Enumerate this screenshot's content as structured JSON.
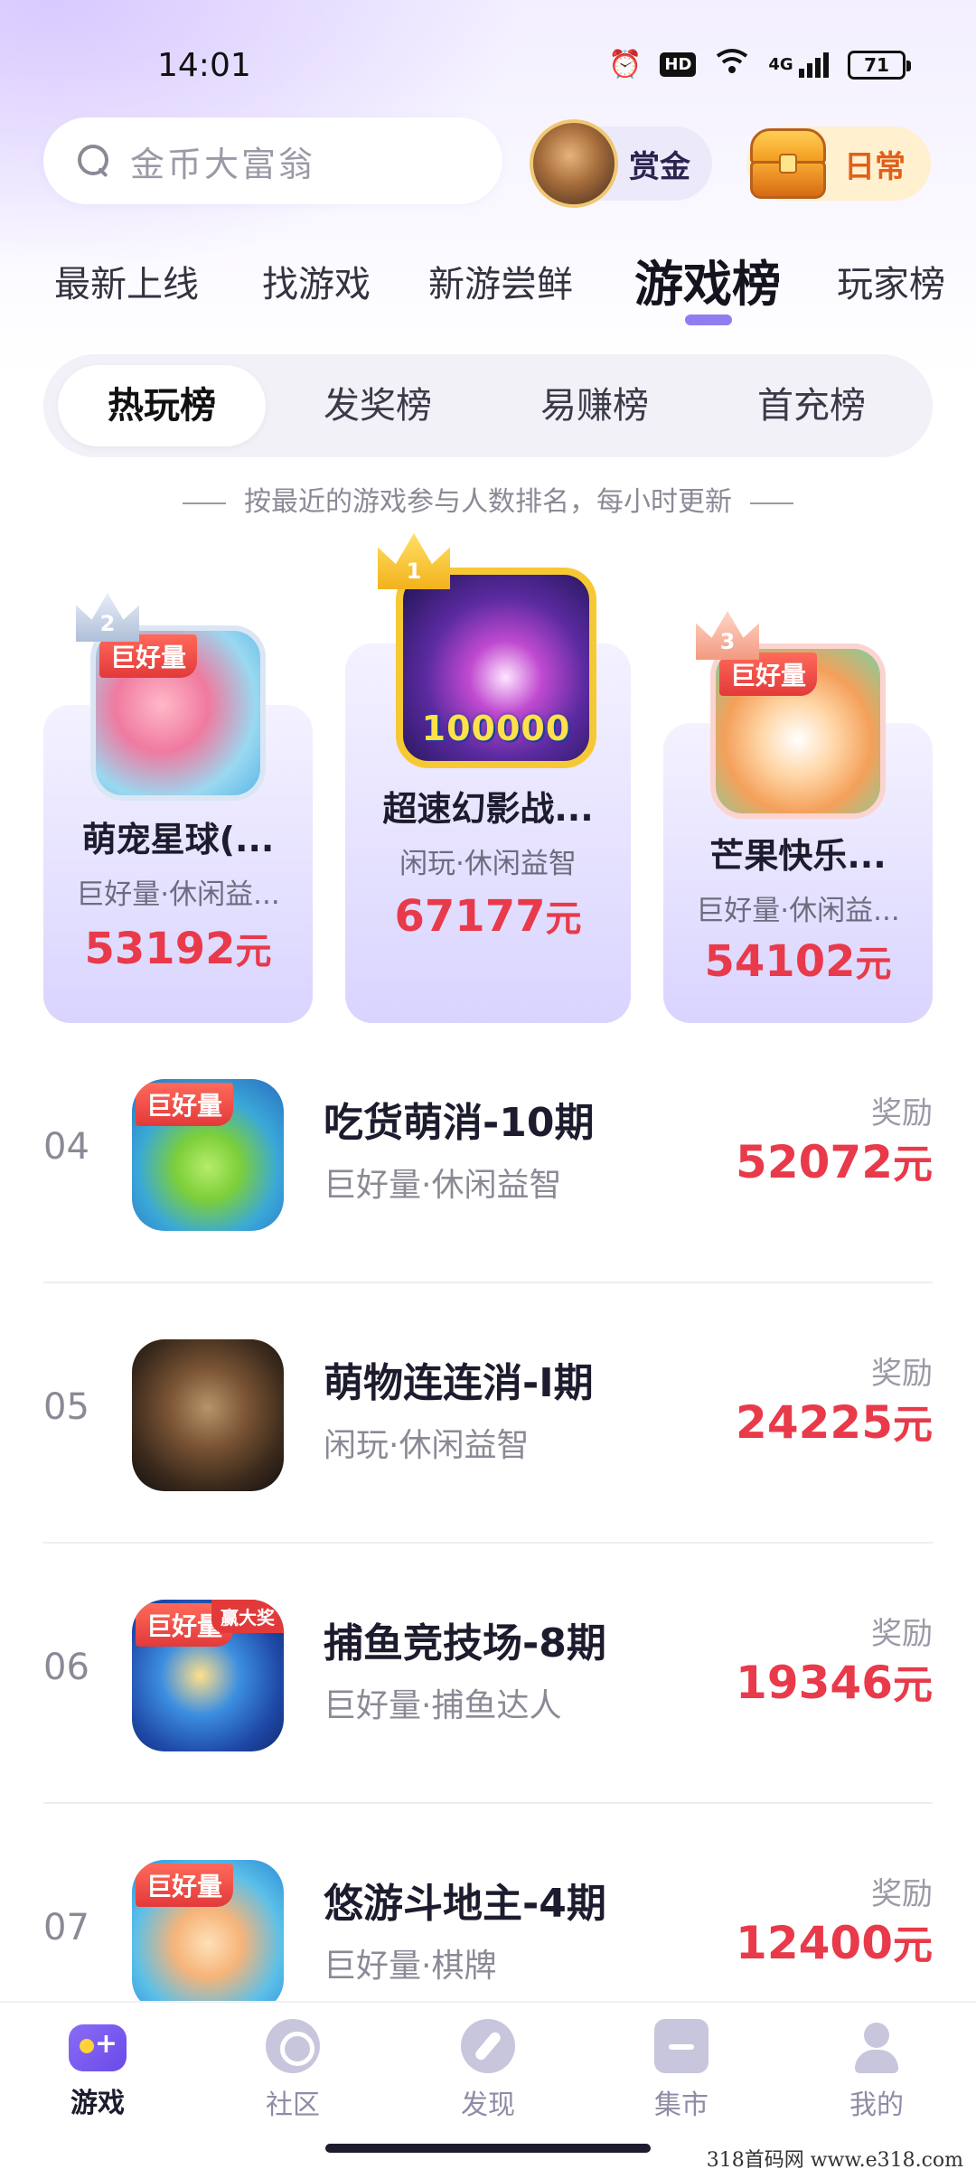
{
  "status_bar": {
    "time": "14:01",
    "icons": [
      "alarm-icon",
      "hd-icon",
      "wifi-icon",
      "4g-signal-icon"
    ],
    "hd_label": "HD",
    "network_label": "4G",
    "battery": "71"
  },
  "search": {
    "placeholder": "金币大富翁",
    "bounty_label": "赏金",
    "daily_label": "日常"
  },
  "main_tabs": [
    {
      "label": "最新上线",
      "active": false
    },
    {
      "label": "找游戏",
      "active": false
    },
    {
      "label": "新游尝鲜",
      "active": false
    },
    {
      "label": "游戏榜",
      "active": true
    },
    {
      "label": "玩家榜",
      "active": false
    }
  ],
  "sub_tabs": [
    {
      "label": "热玩榜",
      "active": true
    },
    {
      "label": "发奖榜",
      "active": false
    },
    {
      "label": "易赚榜",
      "active": false
    },
    {
      "label": "首充榜",
      "active": false
    }
  ],
  "rank_note": "按最近的游戏参与人数排名，每小时更新",
  "podium": {
    "first": {
      "rank": "1",
      "name": "超速幻影战...",
      "tags": "闲玩·休闲益智",
      "reward": "67177",
      "unit": "元",
      "icon_text": "100000"
    },
    "second": {
      "rank": "2",
      "name": "萌宠星球(...",
      "tags": "巨好量·休闲益...",
      "reward": "53192",
      "unit": "元",
      "badge": "巨好量"
    },
    "third": {
      "rank": "3",
      "name": "芒果快乐...",
      "tags": "巨好量·休闲益...",
      "reward": "54102",
      "unit": "元",
      "badge": "巨好量"
    }
  },
  "list": [
    {
      "rank": "04",
      "title": "吃货萌消-10期",
      "tags": "巨好量·休闲益智",
      "reward_label": "奖励",
      "reward": "52072",
      "unit": "元",
      "badge": "巨好量"
    },
    {
      "rank": "05",
      "title": "萌物连连消-I期",
      "tags": "闲玩·休闲益智",
      "reward_label": "奖励",
      "reward": "24225",
      "unit": "元"
    },
    {
      "rank": "06",
      "title": "捕鱼竞技场-8期",
      "tags": "巨好量·捕鱼达人",
      "reward_label": "奖励",
      "reward": "19346",
      "unit": "元",
      "badge": "巨好量",
      "corner": "赢大奖"
    },
    {
      "rank": "07",
      "title": "悠游斗地主-4期",
      "tags": "巨好量·棋牌",
      "reward_label": "奖励",
      "reward": "12400",
      "unit": "元",
      "badge": "巨好量"
    }
  ],
  "bottom_nav": [
    {
      "label": "游戏",
      "icon": "gamepad-icon",
      "active": true
    },
    {
      "label": "社区",
      "icon": "community-icon",
      "active": false
    },
    {
      "label": "发现",
      "icon": "compass-icon",
      "active": false
    },
    {
      "label": "集市",
      "icon": "market-icon",
      "active": false
    },
    {
      "label": "我的",
      "icon": "profile-icon",
      "active": false
    }
  ],
  "watermark": "318首码网  www.e318.com",
  "colors": {
    "accent": "#8f7ef2",
    "reward_red": "#e83a4a",
    "card_gradient_bottom": "#d9d4ff",
    "daily_orange": "#e0601a"
  }
}
